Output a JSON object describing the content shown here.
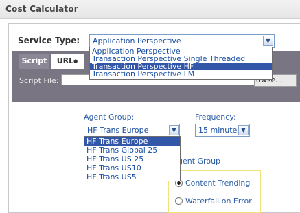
{
  "window": {
    "title": "Cost Calculator"
  },
  "service_type": {
    "label": "Service Type:",
    "selected": "Application Perspective",
    "options": [
      "Application Perspective",
      "Transaction Perspective Single Threaded",
      "Transaction Perspective HF",
      "Transaction Perspective LM"
    ],
    "highlighted_index": 2
  },
  "tabs": [
    {
      "label": "Script"
    },
    {
      "label": "URL"
    }
  ],
  "script_file": {
    "label": "Script File:",
    "value": "",
    "browse_label": "owse..."
  },
  "agent_group": {
    "label": "Agent Group:",
    "selected": "HF Trans Europe",
    "options": [
      "HF Trans Europe",
      "HF Trans Global 25",
      "HF Trans US 25",
      "HF Trans US10",
      "HF Trans US5"
    ],
    "highlighted_index": 0,
    "partial_label": "gent Group"
  },
  "frequency": {
    "label": "Frequency:",
    "selected": "15 minutes"
  },
  "options_box": {
    "content_trending": "Content Trending",
    "waterfall_on_error": "Waterfall on Error",
    "selected": "content_trending"
  },
  "colors": {
    "highlight": "#3256a8",
    "link_blue": "#2e5fa8",
    "band": "#7a7583"
  }
}
